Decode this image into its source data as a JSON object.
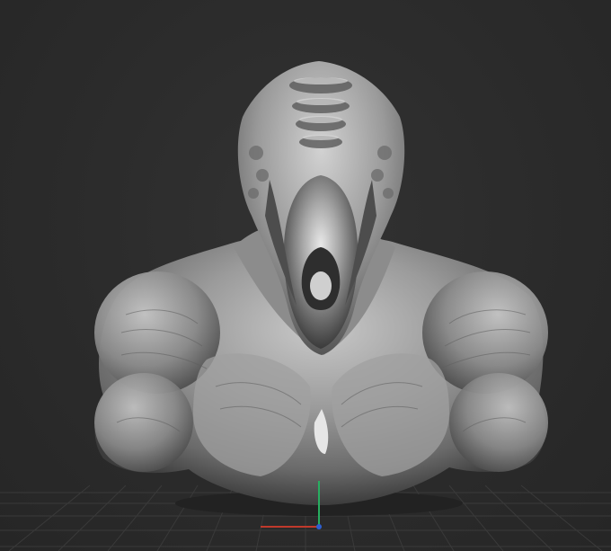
{
  "viewport": {
    "background_color": "#2b2b2b",
    "grid_color": "#3a3a3a",
    "model_color": "#9a9a9a",
    "axis_colors": {
      "x": "#c0392b",
      "y": "#27ae60",
      "z": "#2e5fd0"
    },
    "grid_visible": true
  },
  "model": {
    "description_icon": "creature-bust-sculpt-icon"
  }
}
